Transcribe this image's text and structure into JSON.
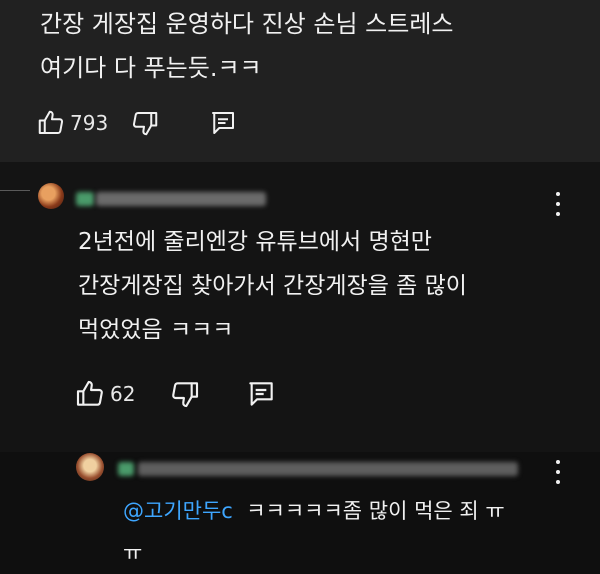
{
  "top_comment": {
    "text": "간장 게장집 운영하다 진상 손님 스트레스\n여기다 다 푸는듯.ㅋㅋ",
    "like_count": "793"
  },
  "reply_1": {
    "text": "2년전에 줄리엔강 유튜브에서 명현만\n간장게장집 찾아가서 간장게장을 좀 많이\n먹었었음 ㅋㅋㅋ",
    "like_count": "62"
  },
  "reply_2": {
    "mention": "@고기만두c",
    "text": "ㅋㅋㅋㅋㅋ좀 많이 먹은 죄 ㅠ\nㅠ"
  },
  "icons": [
    "thumbs-up-icon",
    "thumbs-down-icon",
    "reply-icon",
    "more-vert-icon"
  ],
  "colors": {
    "background": "#0f0f0f",
    "top_panel": "#212121",
    "mention": "#3ea6ff",
    "text": "#f1f1f1"
  }
}
